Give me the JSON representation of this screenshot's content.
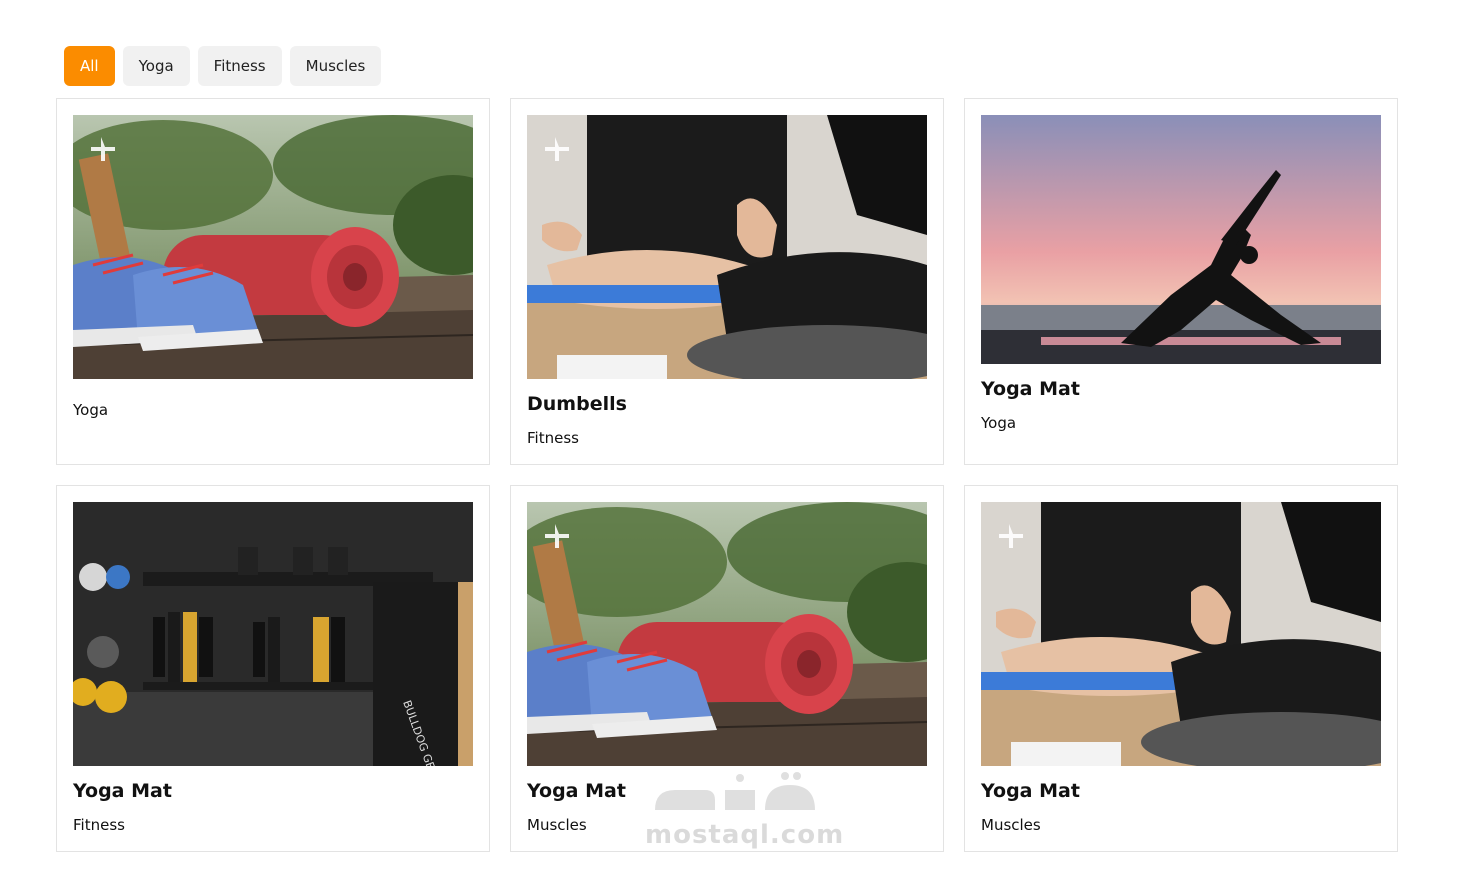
{
  "filters": [
    {
      "label": "All",
      "active": true
    },
    {
      "label": "Yoga",
      "active": false
    },
    {
      "label": "Fitness",
      "active": false
    },
    {
      "label": "Muscles",
      "active": false
    }
  ],
  "cards": [
    {
      "title": "",
      "category": "Yoga",
      "image": "yoga-mat-sneakers-photo"
    },
    {
      "title": "Dumbells",
      "category": "Fitness",
      "image": "meditation-couple-photo"
    },
    {
      "title": "Yoga Mat",
      "category": "Yoga",
      "image": "sunset-yoga-pose-photo"
    },
    {
      "title": "Yoga Mat",
      "category": "Fitness",
      "image": "gym-weights-rack-photo"
    },
    {
      "title": "Yoga Mat",
      "category": "Muscles",
      "image": "yoga-mat-sneakers-photo"
    },
    {
      "title": "Yoga Mat",
      "category": "Muscles",
      "image": "meditation-couple-photo"
    }
  ],
  "watermark": {
    "text": "mostaql.com",
    "arabic": "مستقل"
  },
  "colors": {
    "accent": "#fb8c00",
    "filter_bg": "#f1f1f1",
    "card_border": "#e3e3e3"
  }
}
